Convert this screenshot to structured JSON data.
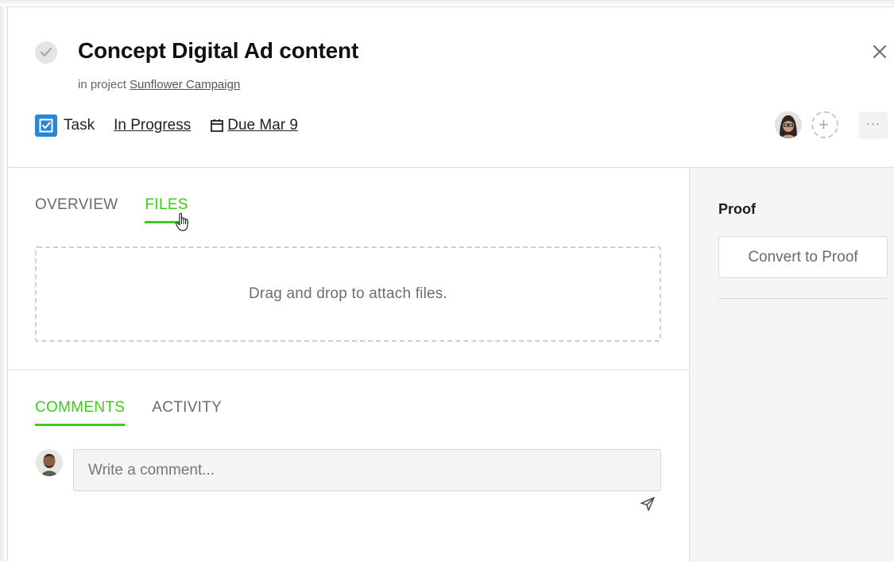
{
  "task": {
    "title": "Concept Digital Ad content",
    "project_prefix": "in project",
    "project_name": "Sunflower Campaign",
    "type_label": "Task",
    "status": "In Progress",
    "due": "Due Mar 9"
  },
  "header_actions": {
    "add_member_symbol": "+",
    "more_symbol": "···",
    "close_symbol": "×"
  },
  "file_tabs": [
    {
      "label": "OVERVIEW",
      "active": false
    },
    {
      "label": "FILES",
      "active": true
    }
  ],
  "dropzone": {
    "text": "Drag and drop to attach files."
  },
  "discussion_tabs": [
    {
      "label": "COMMENTS",
      "active": true
    },
    {
      "label": "ACTIVITY",
      "active": false
    }
  ],
  "comment": {
    "placeholder": "Write a comment..."
  },
  "proof": {
    "heading": "Proof",
    "button": "Convert to Proof"
  },
  "colors": {
    "accent": "#3ecb1a",
    "task_icon": "#2a86d6"
  },
  "icons": [
    "check-circle-icon",
    "close-icon",
    "task-icon",
    "calendar-icon",
    "add-person-icon",
    "more-icon",
    "send-icon",
    "hand-cursor-icon"
  ]
}
